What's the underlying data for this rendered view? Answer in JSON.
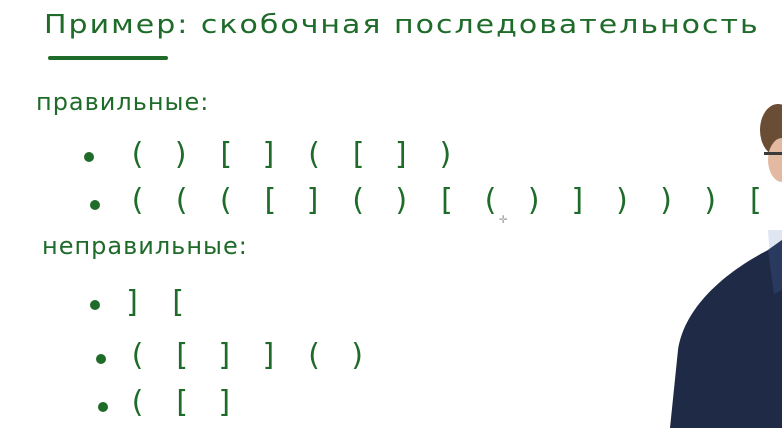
{
  "title": "Пример: скобочная последовательность",
  "sections": {
    "correct": {
      "heading": "правильные:",
      "items": [
        "( ) [ ] ( [ ] )",
        "( ( ( [ ] ( ) [ ( ) ] ) ) ) [ ]"
      ]
    },
    "incorrect": {
      "heading": "неправильные:",
      "items": [
        "] [",
        "( [ ] ] ( )",
        "( [ ]"
      ]
    }
  },
  "colors": {
    "ink": "#1f6b2a",
    "background": "#ffffff"
  }
}
